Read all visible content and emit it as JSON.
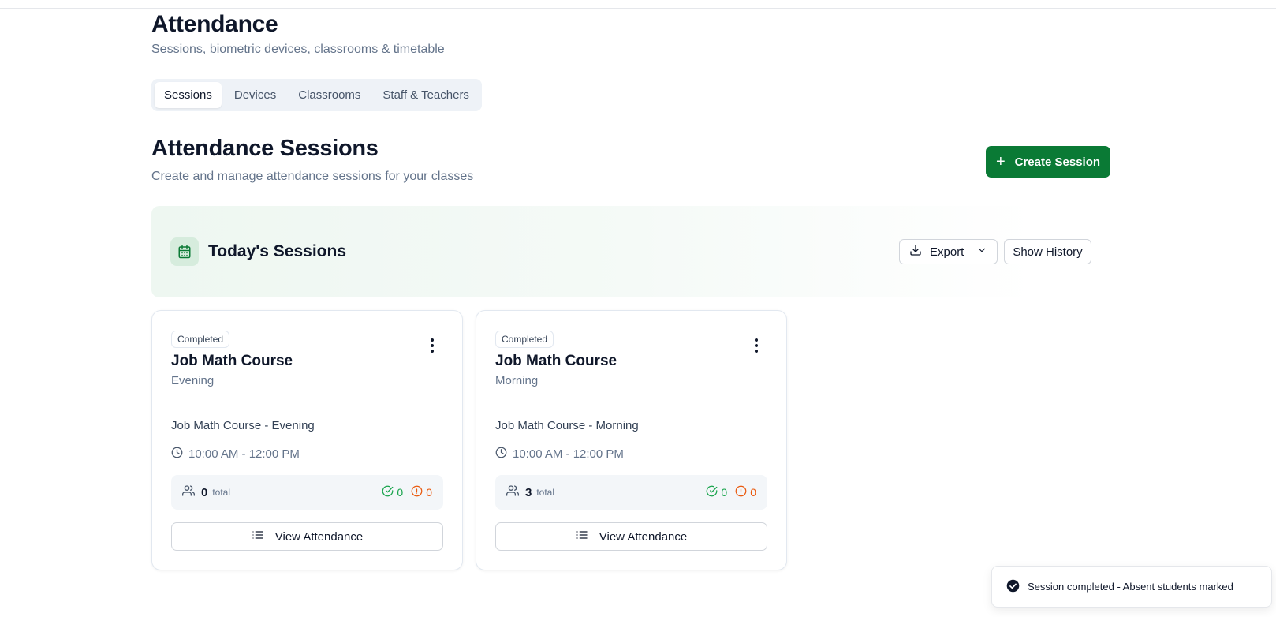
{
  "header": {
    "title": "Attendance",
    "subtitle": "Sessions, biometric devices, classrooms & timetable"
  },
  "tabs": [
    {
      "label": "Sessions",
      "active": true
    },
    {
      "label": "Devices",
      "active": false
    },
    {
      "label": "Classrooms",
      "active": false
    },
    {
      "label": "Staff & Teachers",
      "active": false
    }
  ],
  "section": {
    "title": "Attendance Sessions",
    "subtitle": "Create and manage attendance sessions for your classes",
    "create_label": "Create Session"
  },
  "today": {
    "title": "Today's Sessions",
    "export_label": "Export",
    "history_label": "Show History"
  },
  "cards": [
    {
      "status": "Completed",
      "course": "Job Math Course",
      "shift": "Evening",
      "session_name": "Job Math Course - Evening",
      "time": "10:00 AM - 12:00 PM",
      "total": "0",
      "total_label": "total",
      "present": "0",
      "absent": "0",
      "view_label": "View Attendance"
    },
    {
      "status": "Completed",
      "course": "Job Math Course",
      "shift": "Morning",
      "session_name": "Job Math Course - Morning",
      "time": "10:00 AM - 12:00 PM",
      "total": "3",
      "total_label": "total",
      "present": "0",
      "absent": "0",
      "view_label": "View Attendance"
    }
  ],
  "toast": {
    "message": "Session completed - Absent students marked"
  },
  "colors": {
    "primary": "#0a7a35",
    "present": "#16a34a",
    "absent": "#ea580c"
  },
  "icons": {
    "create": "plus-icon",
    "calendar": "calendar-icon",
    "export": "download-icon",
    "dropdown": "chevron-down-icon",
    "menu": "more-vertical-icon",
    "time": "clock-icon",
    "users": "users-icon",
    "present": "check-circle-icon",
    "absent": "alert-circle-icon",
    "view": "list-icon",
    "toast": "check-badge-icon"
  }
}
